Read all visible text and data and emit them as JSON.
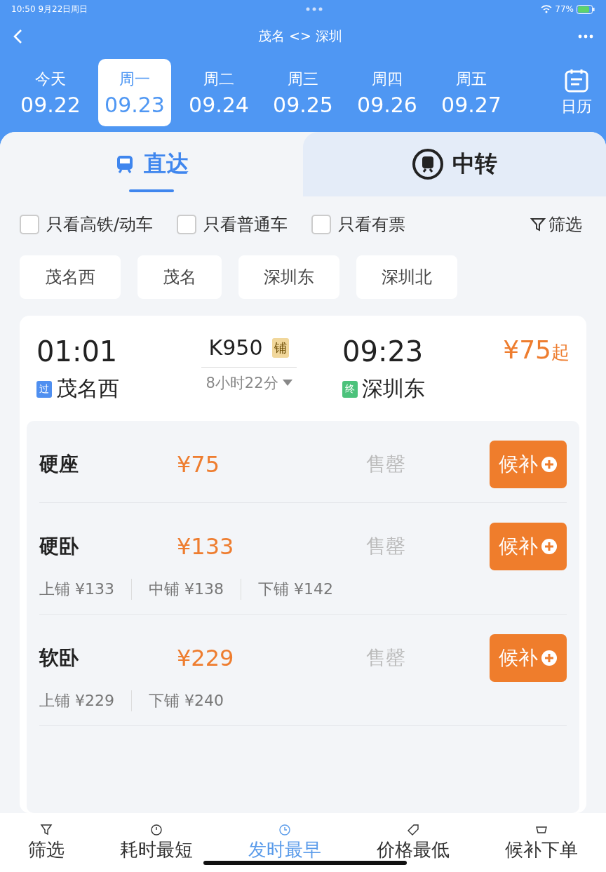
{
  "status_bar": {
    "time": "10:50",
    "date": "9月22日周日",
    "battery": "77%"
  },
  "nav": {
    "title": "茂名 <> 深圳"
  },
  "dates": [
    {
      "weekday": "今天",
      "date": "09.22",
      "selected": false
    },
    {
      "weekday": "周一",
      "date": "09.23",
      "selected": true
    },
    {
      "weekday": "周二",
      "date": "09.24",
      "selected": false
    },
    {
      "weekday": "周三",
      "date": "09.25",
      "selected": false
    },
    {
      "weekday": "周四",
      "date": "09.26",
      "selected": false
    },
    {
      "weekday": "周五",
      "date": "09.27",
      "selected": false
    }
  ],
  "calendar_label": "日历",
  "modes": [
    {
      "label": "直达",
      "selected": true
    },
    {
      "label": "中转",
      "selected": false
    }
  ],
  "filters": [
    {
      "label": "只看高铁/动车",
      "checked": false
    },
    {
      "label": "只看普通车",
      "checked": false
    },
    {
      "label": "只看有票",
      "checked": false
    }
  ],
  "filter_button": "筛选",
  "stations": [
    "茂名西",
    "茂名",
    "深圳东",
    "深圳北"
  ],
  "train": {
    "depart_time": "01:01",
    "depart_tag": "过",
    "depart_station": "茂名西",
    "number": "K950",
    "badge": "铺",
    "duration": "8小时22分",
    "arrive_time": "09:23",
    "arrive_tag": "终",
    "arrive_station": "深圳东",
    "price": "¥75",
    "price_suffix": "起"
  },
  "seats": [
    {
      "name": "硬座",
      "price": "¥75",
      "status": "售罄",
      "action": "候补"
    },
    {
      "name": "硬卧",
      "price": "¥133",
      "status": "售罄",
      "action": "候补",
      "berths": [
        "上铺 ¥133",
        "中铺 ¥138",
        "下铺 ¥142"
      ]
    },
    {
      "name": "软卧",
      "price": "¥229",
      "status": "售罄",
      "action": "候补",
      "berths": [
        "上铺 ¥229",
        "下铺 ¥240"
      ]
    }
  ],
  "bottom_bar": [
    {
      "label": "筛选",
      "selected": false
    },
    {
      "label": "耗时最短",
      "selected": false
    },
    {
      "label": "发时最早",
      "selected": true
    },
    {
      "label": "价格最低",
      "selected": false
    },
    {
      "label": "候补下单",
      "selected": false
    }
  ]
}
